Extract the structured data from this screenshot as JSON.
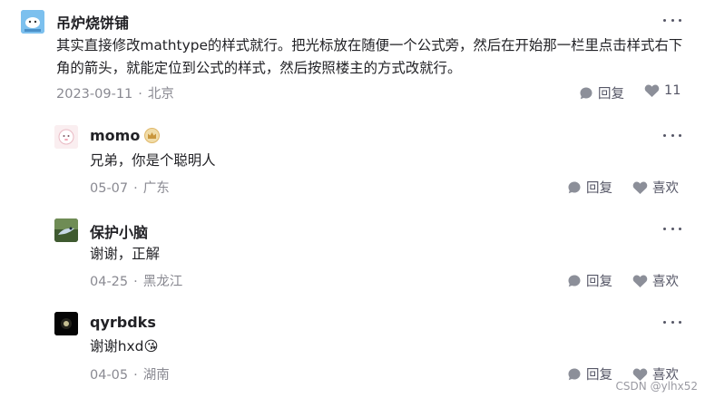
{
  "comments": [
    {
      "user": "吊炉烧饼铺",
      "content": "其实直接修改mathtype的样式就行。把光标放在随便一个公式旁，然后在开始那一栏里点击样式右下角的箭头，就能定位到公式的样式，然后按照楼主的方式改就行。",
      "date": "2023-09-11",
      "location": "北京",
      "reply_label": "回复",
      "like_label": "11"
    },
    {
      "user": "momo",
      "content": "兄弟，你是个聪明人",
      "date": "05-07",
      "location": "广东",
      "reply_label": "回复",
      "like_label": "喜欢"
    },
    {
      "user": "保护小脑",
      "content": "谢谢，正解",
      "date": "04-25",
      "location": "黑龙江",
      "reply_label": "回复",
      "like_label": "喜欢"
    },
    {
      "user": "qyrbdks",
      "content": "谢谢hxd",
      "emoji": "😘",
      "date": "04-05",
      "location": "湖南",
      "reply_label": "回复",
      "like_label": "喜欢"
    }
  ],
  "separator": "·",
  "watermark": "CSDN @ylhx52",
  "icons": {
    "more": "more-icon",
    "reply": "reply-bubble-icon",
    "like": "heart-icon",
    "vip": "crown-badge-icon"
  },
  "colors": {
    "meta": "#8a8a92",
    "action": "#555666",
    "icon": "#8c8f99"
  }
}
